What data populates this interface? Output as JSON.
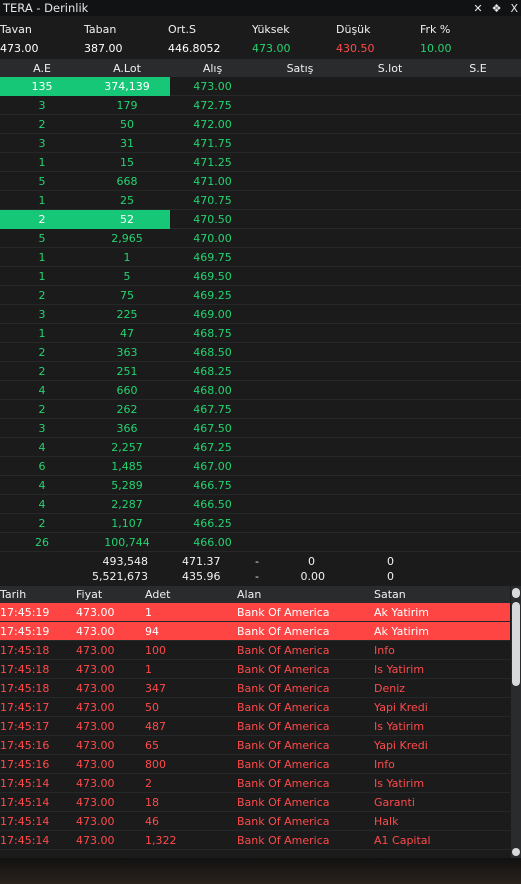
{
  "window": {
    "title": "TERA - Derinlik",
    "controls": [
      "✕",
      "❖",
      "X"
    ]
  },
  "stats": {
    "labels": [
      "Tavan",
      "Taban",
      "Ort.S",
      "Yüksek",
      "Düşük",
      "Frk %"
    ],
    "values": [
      "473.00",
      "387.00",
      "446.8052",
      "473.00",
      "430.50",
      "10.00"
    ]
  },
  "depth": {
    "headers": [
      "A.E",
      "A.Lot",
      "Alış",
      "Satış",
      "S.lot",
      "S.E"
    ],
    "rows": [
      {
        "ae": "135",
        "alot": "374,139",
        "alis": "473.00"
      },
      {
        "ae": "3",
        "alot": "179",
        "alis": "472.75"
      },
      {
        "ae": "2",
        "alot": "50",
        "alis": "472.00"
      },
      {
        "ae": "3",
        "alot": "31",
        "alis": "471.75"
      },
      {
        "ae": "1",
        "alot": "15",
        "alis": "471.25"
      },
      {
        "ae": "5",
        "alot": "668",
        "alis": "471.00"
      },
      {
        "ae": "1",
        "alot": "25",
        "alis": "470.75"
      },
      {
        "ae": "2",
        "alot": "52",
        "alis": "470.50"
      },
      {
        "ae": "5",
        "alot": "2,965",
        "alis": "470.00"
      },
      {
        "ae": "1",
        "alot": "1",
        "alis": "469.75"
      },
      {
        "ae": "1",
        "alot": "5",
        "alis": "469.50"
      },
      {
        "ae": "2",
        "alot": "75",
        "alis": "469.25"
      },
      {
        "ae": "3",
        "alot": "225",
        "alis": "469.00"
      },
      {
        "ae": "1",
        "alot": "47",
        "alis": "468.75"
      },
      {
        "ae": "2",
        "alot": "363",
        "alis": "468.50"
      },
      {
        "ae": "2",
        "alot": "251",
        "alis": "468.25"
      },
      {
        "ae": "4",
        "alot": "660",
        "alis": "468.00"
      },
      {
        "ae": "2",
        "alot": "262",
        "alis": "467.75"
      },
      {
        "ae": "3",
        "alot": "366",
        "alis": "467.50"
      },
      {
        "ae": "4",
        "alot": "2,257",
        "alis": "467.25"
      },
      {
        "ae": "6",
        "alot": "1,485",
        "alis": "467.00"
      },
      {
        "ae": "4",
        "alot": "5,289",
        "alis": "466.75"
      },
      {
        "ae": "4",
        "alot": "2,287",
        "alis": "466.50"
      },
      {
        "ae": "2",
        "alot": "1,107",
        "alis": "466.25"
      },
      {
        "ae": "26",
        "alot": "100,744",
        "alis": "466.00"
      }
    ],
    "highlighted_rows": [
      0,
      7
    ],
    "summary": [
      {
        "alot": "493,548",
        "alis": "471.37",
        "satis": "-",
        "satis_val": "0",
        "slot": "0"
      },
      {
        "alot": "5,521,673",
        "alis": "435.96",
        "satis": "-",
        "satis_val": "0.00",
        "slot": "0"
      }
    ]
  },
  "trades": {
    "headers": [
      "Tarih",
      "Fiyat",
      "Adet",
      "Alan",
      "Satan"
    ],
    "rows": [
      {
        "tarih": "17:45:19",
        "fiyat": "473.00",
        "adet": "1",
        "alan": "Bank Of America",
        "satan": "Ak Yatirim"
      },
      {
        "tarih": "17:45:19",
        "fiyat": "473.00",
        "adet": "94",
        "alan": "Bank Of America",
        "satan": "Ak Yatirim"
      },
      {
        "tarih": "17:45:18",
        "fiyat": "473.00",
        "adet": "100",
        "alan": "Bank Of America",
        "satan": "Info"
      },
      {
        "tarih": "17:45:18",
        "fiyat": "473.00",
        "adet": "1",
        "alan": "Bank Of America",
        "satan": "Is Yatirim"
      },
      {
        "tarih": "17:45:18",
        "fiyat": "473.00",
        "adet": "347",
        "alan": "Bank Of America",
        "satan": "Deniz"
      },
      {
        "tarih": "17:45:17",
        "fiyat": "473.00",
        "adet": "50",
        "alan": "Bank Of America",
        "satan": "Yapi Kredi"
      },
      {
        "tarih": "17:45:17",
        "fiyat": "473.00",
        "adet": "487",
        "alan": "Bank Of America",
        "satan": "Is Yatirim"
      },
      {
        "tarih": "17:45:16",
        "fiyat": "473.00",
        "adet": "65",
        "alan": "Bank Of America",
        "satan": "Yapi Kredi"
      },
      {
        "tarih": "17:45:16",
        "fiyat": "473.00",
        "adet": "800",
        "alan": "Bank Of America",
        "satan": "Info"
      },
      {
        "tarih": "17:45:14",
        "fiyat": "473.00",
        "adet": "2",
        "alan": "Bank Of America",
        "satan": "Is Yatirim"
      },
      {
        "tarih": "17:45:14",
        "fiyat": "473.00",
        "adet": "18",
        "alan": "Bank Of America",
        "satan": "Garanti"
      },
      {
        "tarih": "17:45:14",
        "fiyat": "473.00",
        "adet": "46",
        "alan": "Bank Of America",
        "satan": "Halk"
      },
      {
        "tarih": "17:45:14",
        "fiyat": "473.00",
        "adet": "1,322",
        "alan": "Bank Of America",
        "satan": "A1 Capital"
      }
    ],
    "highlighted_rows": [
      0,
      1
    ]
  },
  "colors": {
    "buy": "#24d36f",
    "sell": "#ff4a4a",
    "highlight_buy": "#16c777",
    "highlight_sell": "#ff4444"
  }
}
